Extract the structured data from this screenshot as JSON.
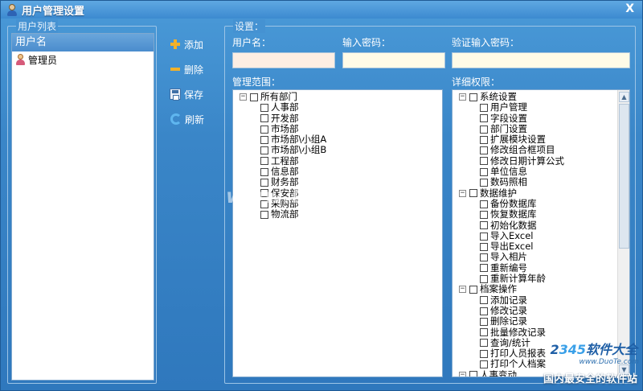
{
  "window": {
    "title": "用户管理设置",
    "close_label": "X"
  },
  "user_group": {
    "label": "用户列表",
    "header": "用户名",
    "users": [
      "管理员"
    ]
  },
  "actions": {
    "add": "添加",
    "delete": "删除",
    "save": "保存",
    "refresh": "刷新"
  },
  "settings": {
    "label": "设置：",
    "username_label": "用户名：",
    "username_value": "",
    "password_label": "输入密码：",
    "password_value": "",
    "confirm_label": "验证输入密码：",
    "confirm_value": "",
    "scope_label": "管理范围：",
    "perm_label": "详细权限："
  },
  "scope_tree": {
    "root": "所有部门",
    "children": [
      "人事部",
      "开发部",
      "市场部",
      "市场部\\小组A",
      "市场部\\小组B",
      "工程部",
      "信息部",
      "财务部",
      "保安部",
      "采购部",
      "物流部"
    ]
  },
  "perm_tree": [
    {
      "label": "系统设置",
      "children": [
        "用户管理",
        "字段设置",
        "部门设置",
        "扩展模块设置",
        "修改组合框项目",
        "修改日期计算公式",
        "单位信息",
        "数码照相"
      ]
    },
    {
      "label": "数据维护",
      "children": [
        "备份数据库",
        "恢复数据库",
        "初始化数据",
        "导入Excel",
        "导出Excel",
        "导入相片",
        "重新编号",
        "重新计算年龄"
      ]
    },
    {
      "label": "档案操作",
      "children": [
        "添加记录",
        "修改记录",
        "删除记录",
        "批量修改记录",
        "查询/统计",
        "打印人员报表",
        "打印个人档案"
      ]
    },
    {
      "label": "人事变动",
      "children": []
    }
  ],
  "watermark": "www.DuoTe.com",
  "logo": {
    "brand_prefix": "2",
    "brand_number": "345",
    "brand_suffix": "软件大全",
    "url": "www.DuoTe.com"
  },
  "bottom_slogan": "国内最安全的软件站"
}
